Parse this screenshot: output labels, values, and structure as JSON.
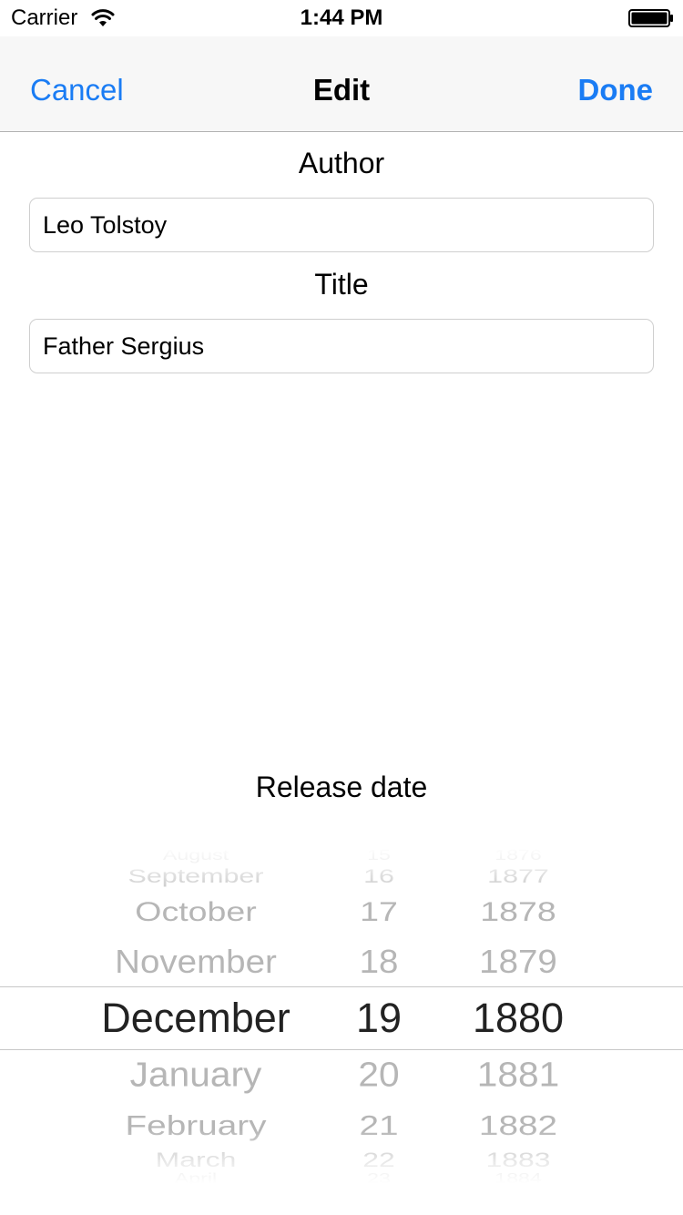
{
  "status_bar": {
    "carrier": "Carrier",
    "time": "1:44 PM"
  },
  "nav": {
    "cancel_label": "Cancel",
    "title": "Edit",
    "done_label": "Done"
  },
  "form": {
    "author_label": "Author",
    "author_value": "Leo Tolstoy",
    "title_label": "Title",
    "title_value": "Father Sergius",
    "release_label": "Release date"
  },
  "picker": {
    "months": [
      "August",
      "September",
      "October",
      "November",
      "December",
      "January",
      "February",
      "March",
      "April"
    ],
    "days": [
      "15",
      "16",
      "17",
      "18",
      "19",
      "20",
      "21",
      "22",
      "23"
    ],
    "years": [
      "1876",
      "1877",
      "1878",
      "1879",
      "1880",
      "1881",
      "1882",
      "1883",
      "1884"
    ],
    "selected": {
      "month": "December",
      "day": "19",
      "year": "1880"
    }
  },
  "colors": {
    "accent": "#1a7cf4",
    "nav_background": "#f7f7f7"
  }
}
